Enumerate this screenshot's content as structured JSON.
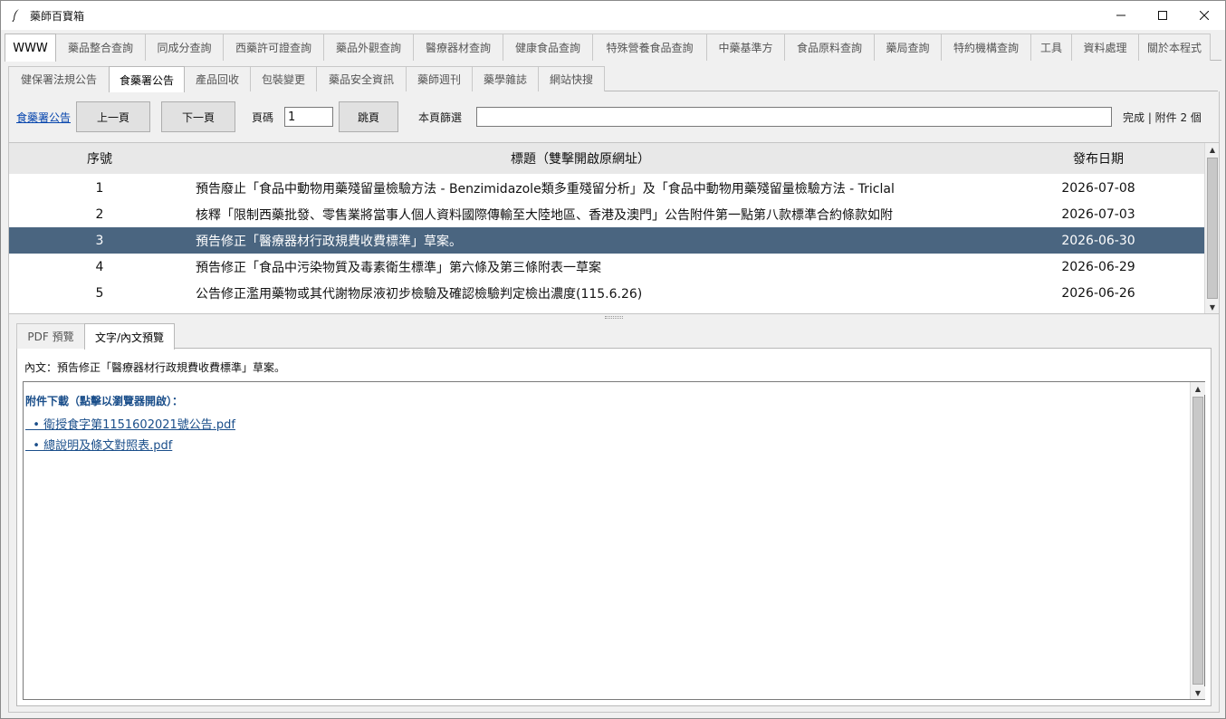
{
  "window": {
    "title": "藥師百寶箱",
    "icon": "feather-icon"
  },
  "main_tabs": [
    {
      "label": "WWW",
      "active": true
    },
    {
      "label": "藥品整合查詢"
    },
    {
      "label": "同成分查詢"
    },
    {
      "label": "西藥許可證查詢"
    },
    {
      "label": "藥品外觀查詢"
    },
    {
      "label": "醫療器材查詢"
    },
    {
      "label": "健康食品查詢"
    },
    {
      "label": "特殊營養食品查詢"
    },
    {
      "label": "中藥基準方"
    },
    {
      "label": "食品原料查詢"
    },
    {
      "label": "藥局查詢"
    },
    {
      "label": "特約機構查詢"
    },
    {
      "label": "工具"
    },
    {
      "label": "資料處理"
    },
    {
      "label": "關於本程式"
    }
  ],
  "sub_tabs": [
    {
      "label": "健保署法規公告"
    },
    {
      "label": "食藥署公告",
      "active": true
    },
    {
      "label": "產品回收"
    },
    {
      "label": "包裝變更"
    },
    {
      "label": "藥品安全資訊"
    },
    {
      "label": "藥師週刊"
    },
    {
      "label": "藥學雜誌"
    },
    {
      "label": "網站快搜"
    }
  ],
  "toolbar": {
    "source_link": "食藥署公告",
    "prev_label": "上一頁",
    "next_label": "下一頁",
    "page_label": "頁碼",
    "page_value": "1",
    "jump_label": "跳頁",
    "filter_label": "本頁篩選",
    "filter_value": "",
    "status": "完成 | 附件 2 個"
  },
  "table": {
    "headers": {
      "num": "序號",
      "title": "標題（雙擊開啟原網址）",
      "date": "發布日期"
    },
    "rows": [
      {
        "num": "1",
        "title": "預告廢止「食品中動物用藥殘留量檢驗方法 - Benzimidazole類多重殘留分析」及「食品中動物用藥殘留量檢驗方法 - Triclal",
        "date": "2026-07-08"
      },
      {
        "num": "2",
        "title": "核釋「限制西藥批發、零售業將當事人個人資料國際傳輸至大陸地區、香港及澳門」公告附件第一點第八款標準合約條款如附",
        "date": "2026-07-03"
      },
      {
        "num": "3",
        "title": "預告修正「醫療器材行政規費收費標準」草案。",
        "date": "2026-06-30",
        "selected": true
      },
      {
        "num": "4",
        "title": "預告修正「食品中污染物質及毒素衛生標準」第六條及第三條附表一草案",
        "date": "2026-06-29"
      },
      {
        "num": "5",
        "title": "公告修正濫用藥物或其代謝物尿液初步檢驗及確認檢驗判定檢出濃度(115.6.26)",
        "date": "2026-06-26"
      }
    ]
  },
  "preview": {
    "tabs": [
      {
        "label": "PDF 預覽"
      },
      {
        "label": "文字/內文預覽",
        "active": true
      }
    ],
    "body_text": "內文：預告修正「醫療器材行政規費收費標準」草案。",
    "attach_header": "附件下載（點擊以瀏覽器開啟）：",
    "attachments": [
      "  • 衛授食字第1151602021號公告.pdf",
      "  • 總說明及條文對照表.pdf"
    ]
  },
  "colors": {
    "selected_row": "#4a6580",
    "link": "#0645ad",
    "attachment_link": "#1a4e8a"
  }
}
